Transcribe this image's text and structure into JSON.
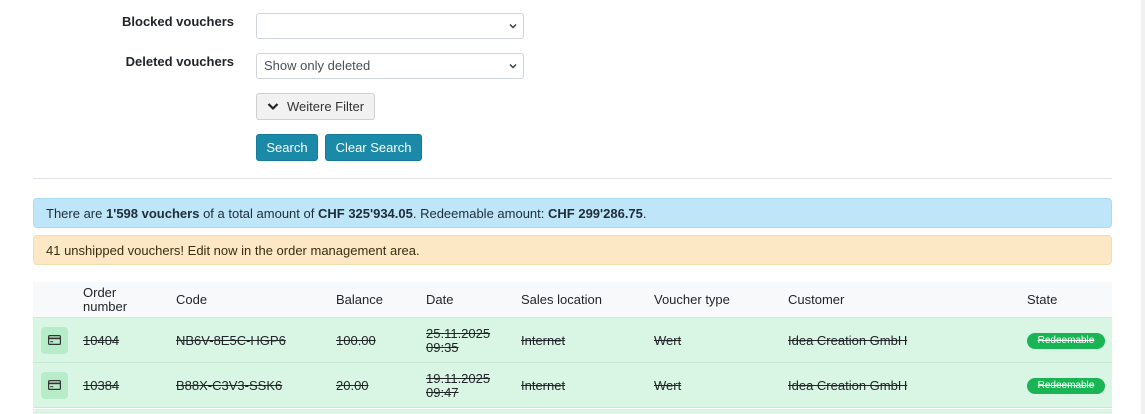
{
  "filters": {
    "blocked": {
      "label": "Blocked vouchers",
      "value": ""
    },
    "deleted": {
      "label": "Deleted vouchers",
      "value": "Show only deleted"
    },
    "more_filters_label": "Weitere Filter",
    "search_label": "Search",
    "clear_label": "Clear Search"
  },
  "summary": {
    "prefix": "There are",
    "count": "1'598 vouchers",
    "mid": "of a total amount of",
    "total": "CHF 325'934.05",
    "redeemable_label": ". Redeemable amount:",
    "redeemable": "CHF 299'286.75",
    "suffix": "."
  },
  "warning": {
    "text": "41 unshipped vouchers! Edit now in the order management area."
  },
  "table": {
    "columns": {
      "order_line1": "Order",
      "order_line2": "number",
      "code": "Code",
      "balance": "Balance",
      "date": "Date",
      "location": "Sales location",
      "type": "Voucher type",
      "customer": "Customer",
      "state": "State"
    },
    "rows": [
      {
        "order": "10404",
        "code": "NB6V-8E5C-HGP6",
        "balance": "100.00",
        "date": "25.11.2025",
        "time": "09:35",
        "location": "Internet",
        "type": "Wert",
        "customer": "Idea Creation GmbH",
        "state": "Redeemable"
      },
      {
        "order": "10384",
        "code": "B88X-C3V3-SSK6",
        "balance": "20.00",
        "date": "19.11.2025",
        "time": "09:47",
        "location": "Internet",
        "type": "Wert",
        "customer": "Idea Creation GmbH",
        "state": "Redeemable"
      }
    ]
  },
  "icons": {
    "select_chevron": "chevron-down-icon",
    "filter_chevron": "chevron-down-icon",
    "row_action": "credit-card-icon"
  },
  "colors": {
    "primary": "#1a8aa8",
    "info_bg": "#bee5f8",
    "warn_bg": "#fce8c4",
    "row_bg": "#d9f6e4",
    "badge": "#19b453"
  }
}
